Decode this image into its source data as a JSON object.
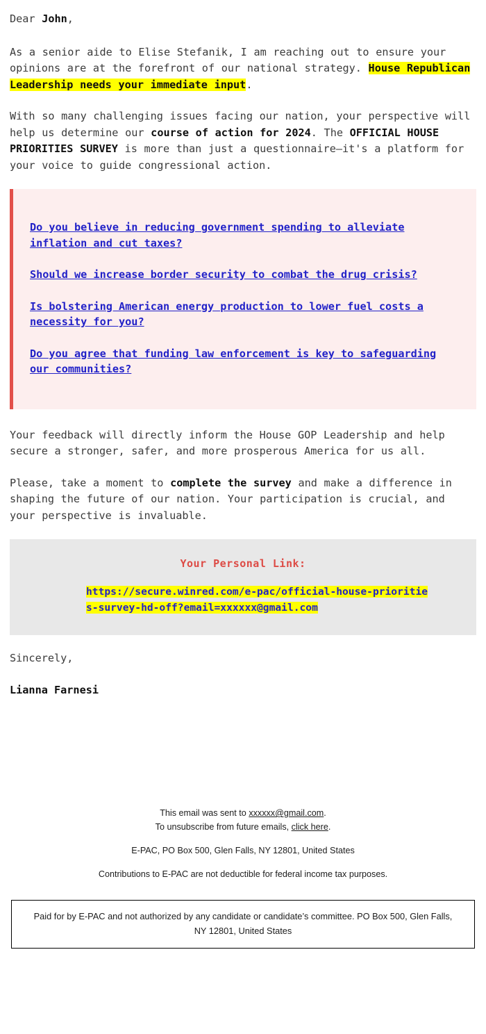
{
  "greeting": {
    "prefix": "Dear ",
    "name": "John",
    "suffix": ","
  },
  "paragraph_1": {
    "part_1": "As a senior aide to Elise Stefanik, I am reaching out to ensure your opinions are at the forefront of our national strategy. ",
    "highlight": "House Republican Leadership needs your immediate input",
    "part_2": "."
  },
  "paragraph_2": {
    "part_1": "With so many challenging issues facing our nation, your perspective will help us determine our ",
    "bold_1": "course of action for 2024",
    "part_2": ". The ",
    "bold_2": "OFFICIAL HOUSE PRIORITIES SURVEY",
    "part_3": " is more than just a questionnaire—it's a platform for your voice to guide congressional action."
  },
  "questions": [
    "Do you believe in reducing government spending to alleviate inflation and cut taxes?",
    "Should we increase border security to combat the drug crisis?",
    "Is bolstering American energy production to lower fuel costs a necessity for you?",
    "Do you agree that funding law enforcement is key to safeguarding our communities?"
  ],
  "paragraph_3": {
    "text": "Your feedback will directly inform the House GOP Leadership and help secure a stronger, safer, and more prosperous America for us all."
  },
  "paragraph_4": {
    "part_1": "Please, take a moment to ",
    "bold_1": "complete the survey",
    "part_2": " and make a difference in shaping the future of our nation. Your participation is crucial, and your perspective is invaluable."
  },
  "personal_link_box": {
    "title": "Your Personal Link:",
    "url": "https://secure.winred.com/e-pac/official-house-priorities-survey-hd-off?email=xxxxxx@gmail.com"
  },
  "signature": {
    "closing": "Sincerely,",
    "name": "Lianna Farnesi"
  },
  "footer": {
    "sent_to_prefix": "This email was sent to ",
    "sent_to_email": "xxxxxx@gmail.com",
    "sent_to_suffix": ".",
    "unsubscribe_prefix": "To unsubscribe from future emails, ",
    "unsubscribe_link": "click here",
    "unsubscribe_suffix": ".",
    "address": "E-PAC, PO Box 500, Glen Falls, NY 12801, United States",
    "tax_notice": "Contributions to E-PAC are not deductible for federal income tax purposes.",
    "disclaimer": "Paid for by E-PAC and not authorized by any candidate or candidate’s committee. PO Box 500, Glen Falls, NY 12801, United States"
  },
  "colors": {
    "highlight_yellow": "#ffff00",
    "link_blue": "#2222c8",
    "accent_red": "#e2504a",
    "question_bg": "#fdeeee",
    "link_box_bg": "#e8e8e8",
    "body_text": "#3b3b3b"
  }
}
